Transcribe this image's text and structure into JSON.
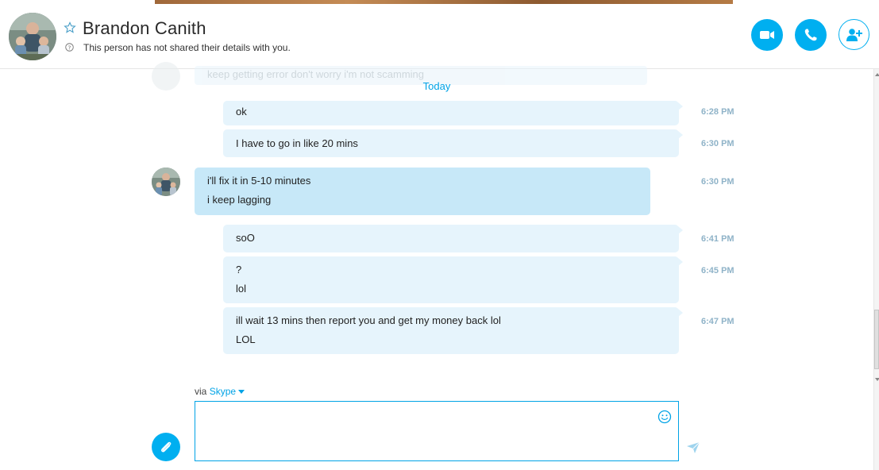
{
  "header": {
    "contact_name": "Brandon Canith",
    "status_text": "This person has not shared their details with you.",
    "buttons": {
      "video_icon": "video-camera-icon",
      "call_icon": "phone-icon",
      "add_contact_icon": "add-person-icon"
    }
  },
  "conversation": {
    "faded_message": "keep getting error don't worry i'm not scamming",
    "date_separator": "Today",
    "messages": [
      {
        "from": "me",
        "lines": [
          "ok"
        ],
        "time": "6:28 PM"
      },
      {
        "from": "me",
        "lines": [
          "I have to go in like 20 mins"
        ],
        "time": "6:30 PM"
      },
      {
        "from": "contact",
        "lines": [
          "i'll fix it in 5-10 minutes",
          "i keep lagging"
        ],
        "time": "6:30 PM"
      },
      {
        "from": "me",
        "lines": [
          "soO"
        ],
        "time": "6:41 PM"
      },
      {
        "from": "me",
        "lines": [
          "?",
          "lol"
        ],
        "time": "6:45 PM"
      },
      {
        "from": "me",
        "lines": [
          "ill wait 13 mins then report you and get my money back lol",
          "LOL"
        ],
        "time": "6:47 PM"
      }
    ]
  },
  "compose": {
    "via_prefix": "via",
    "via_service": "Skype",
    "message_value": ""
  },
  "colors": {
    "accent": "#00aff0",
    "outgoing_bubble": "#e6f4fc",
    "incoming_bubble": "#c7e8f8",
    "timestamp": "#8fb3c8"
  }
}
